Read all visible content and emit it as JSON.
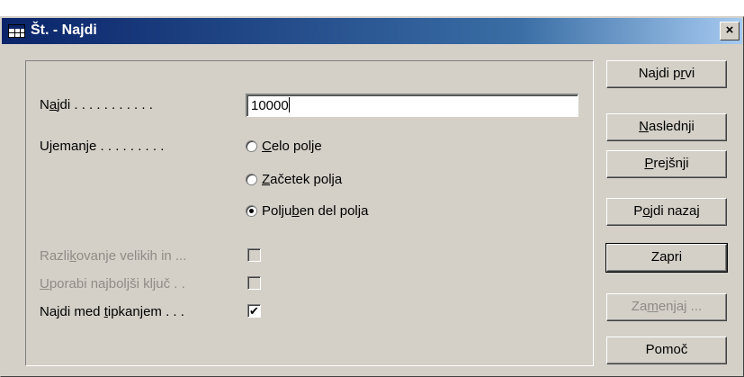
{
  "window": {
    "title": "Št. - Najdi",
    "close_label": "×"
  },
  "find": {
    "label_pre": "N",
    "label_acc": "a",
    "label_post": "jdi . . . . . . . . . . .",
    "value": "10000"
  },
  "match": {
    "label": "Ujemanje . . . . . . . . .",
    "options": [
      {
        "pre": "",
        "acc": "C",
        "post": "elo polje",
        "selected": false
      },
      {
        "pre": "",
        "acc": "Z",
        "post": "ačetek polja",
        "selected": false
      },
      {
        "pre": "Polju",
        "acc": "b",
        "post": "en del polja",
        "selected": true
      }
    ]
  },
  "case_sensitive": {
    "pre": "Razli",
    "acc": "k",
    "post": "ovanje velikih in ...",
    "checked": false,
    "enabled": false
  },
  "best_key": {
    "pre": "",
    "acc": "U",
    "post": "porabi najboljši ključ . .",
    "checked": false,
    "enabled": false
  },
  "find_as_you_type": {
    "pre": "Najdi med ",
    "acc": "t",
    "post": "ipkanjem . . .",
    "checked": true,
    "enabled": true,
    "mark": "✔"
  },
  "buttons": {
    "find_first": {
      "pre": "Najdi p",
      "acc": "r",
      "post": "vi"
    },
    "next": {
      "pre": "",
      "acc": "N",
      "post": "aslednji"
    },
    "previous": {
      "pre": "",
      "acc": "P",
      "post": "rejšnji"
    },
    "go_back": {
      "pre": "P",
      "acc": "o",
      "post": "jdi nazaj"
    },
    "close": {
      "pre": "Zapri",
      "acc": "",
      "post": ""
    },
    "replace": {
      "pre": "Za",
      "acc": "m",
      "post": "enjaj ..."
    },
    "help": {
      "pre": "Pomoč",
      "acc": "",
      "post": ""
    }
  }
}
